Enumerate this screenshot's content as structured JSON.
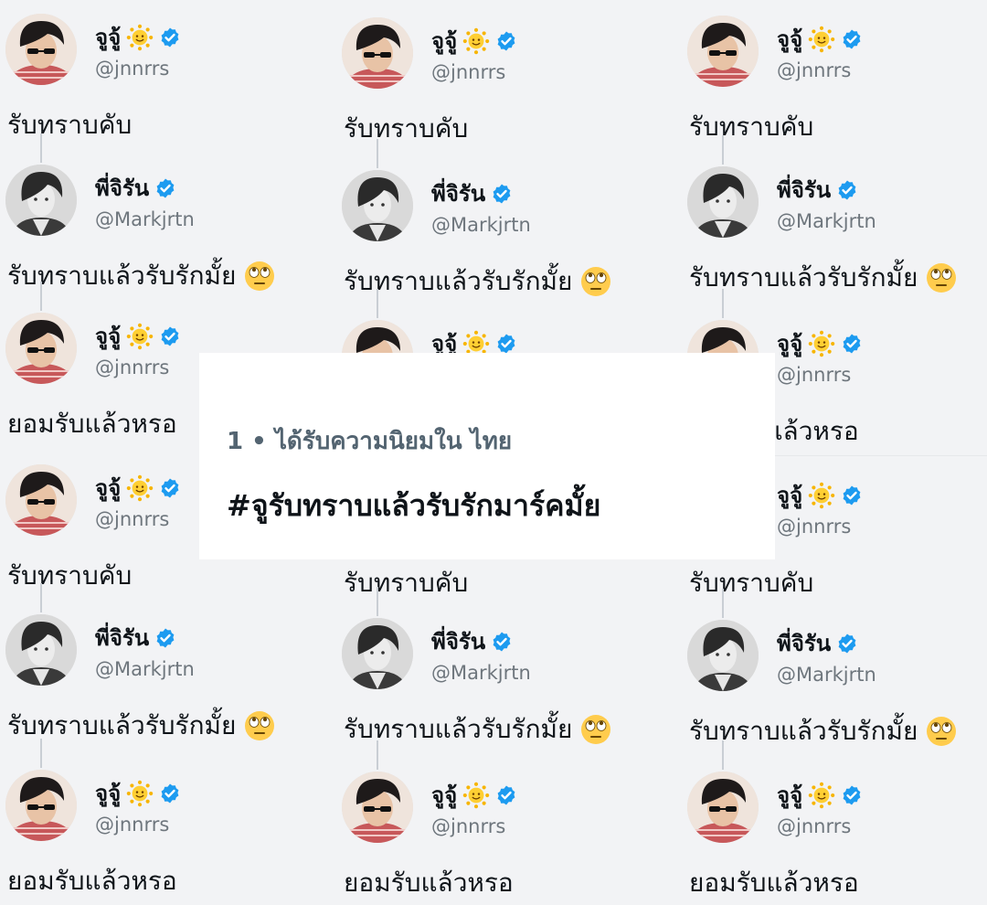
{
  "user_a": {
    "name": "จูจู้",
    "handle": "@jnnrrs",
    "icon": "sun-emoji-icon"
  },
  "user_b": {
    "name": "พี่จิรัน",
    "handle": "@Markjrtn"
  },
  "texts": {
    "ack": "รับทราบคับ",
    "love": "รับทราบแล้วรับรักมั้ย",
    "really": "ยอมรับแล้วหรอ"
  },
  "colors": {
    "verified": "#1d9bf0",
    "muted": "#6e767d",
    "line": "#c9ced4"
  },
  "trend": {
    "rank_label": "1 • ได้รับความนิยมใน ไทย",
    "hashtag": "#จูรับทราบแล้วรับรักมาร์คมั้ย"
  }
}
